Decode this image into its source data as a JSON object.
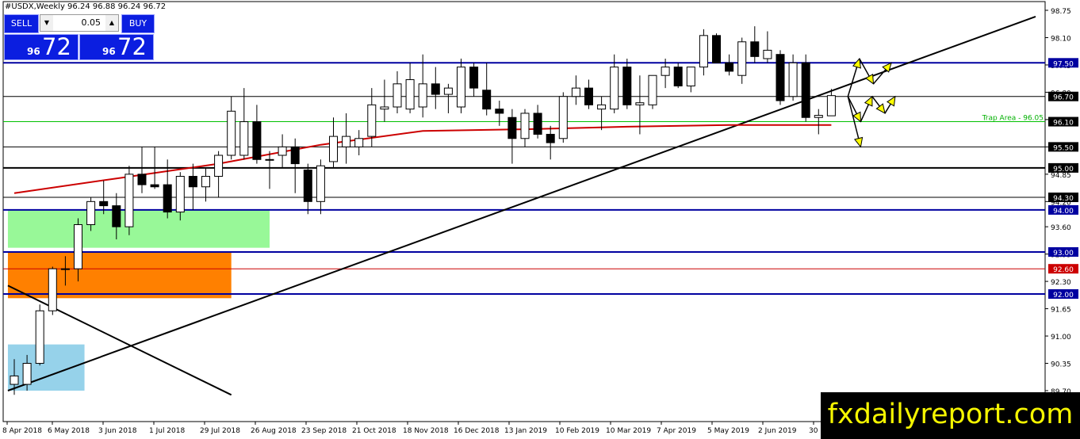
{
  "header": {
    "title": "#USDX,Weekly  96.24 96.88 96.24 96.72"
  },
  "trade_panel": {
    "sell_label": "SELL",
    "buy_label": "BUY",
    "lot": "0.05",
    "sell_small": "96",
    "sell_big": "72",
    "buy_small": "96",
    "buy_big": "72",
    "colors": {
      "button": "#0b1ee0"
    }
  },
  "brand": "fxdailyreport.com",
  "chart_data": {
    "type": "candlestick",
    "symbol": "#USDX",
    "timeframe": "Weekly",
    "ylim": [
      89.7,
      98.75
    ],
    "grid": false,
    "colors": {
      "up": "#ffffff",
      "down": "#000000",
      "ma": "#cc0000",
      "level_blue": "#0000a0",
      "zone_green": "#98f898",
      "zone_orange": "#ff8000",
      "zone_blue": "#96d2ea"
    },
    "y_ticks": [
      "98.75",
      "98.10",
      "97.45",
      "96.80",
      "96.15",
      "95.50",
      "94.85",
      "94.20",
      "93.60",
      "92.95",
      "92.30",
      "91.65",
      "91.00",
      "90.35",
      "89.70"
    ],
    "x_labels": [
      "8 Apr 2018",
      "6 May 2018",
      "3 Jun 2018",
      "1 Jul 2018",
      "29 Jul 2018",
      "26 Aug 2018",
      "23 Sep 2018",
      "21 Oct 2018",
      "18 Nov 2018",
      "16 Dec 2018",
      "13 Jan 2019",
      "10 Feb 2019",
      "10 Mar 2019",
      "7 Apr 2019",
      "5 May 2019",
      "2 Jun 2019",
      "30"
    ],
    "candles": [
      {
        "o": 89.85,
        "h": 90.45,
        "l": 89.6,
        "c": 90.05
      },
      {
        "o": 89.85,
        "h": 90.55,
        "l": 89.7,
        "c": 90.35
      },
      {
        "o": 90.35,
        "h": 91.75,
        "l": 90.3,
        "c": 91.6
      },
      {
        "o": 91.6,
        "h": 92.65,
        "l": 91.5,
        "c": 92.6
      },
      {
        "o": 92.6,
        "h": 92.9,
        "l": 92.2,
        "c": 92.6
      },
      {
        "o": 92.6,
        "h": 93.8,
        "l": 92.3,
        "c": 93.65
      },
      {
        "o": 93.65,
        "h": 94.3,
        "l": 93.5,
        "c": 94.2
      },
      {
        "o": 94.2,
        "h": 94.7,
        "l": 93.9,
        "c": 94.1
      },
      {
        "o": 94.1,
        "h": 94.4,
        "l": 93.3,
        "c": 93.6
      },
      {
        "o": 93.6,
        "h": 95.05,
        "l": 93.4,
        "c": 94.85
      },
      {
        "o": 94.85,
        "h": 95.5,
        "l": 94.4,
        "c": 94.6
      },
      {
        "o": 94.6,
        "h": 95.5,
        "l": 94.5,
        "c": 94.55
      },
      {
        "o": 94.6,
        "h": 95.2,
        "l": 93.8,
        "c": 93.95
      },
      {
        "o": 93.95,
        "h": 94.9,
        "l": 93.75,
        "c": 94.8
      },
      {
        "o": 94.8,
        "h": 95.1,
        "l": 94.0,
        "c": 94.55
      },
      {
        "o": 94.55,
        "h": 95.0,
        "l": 94.2,
        "c": 94.8
      },
      {
        "o": 94.8,
        "h": 95.4,
        "l": 94.3,
        "c": 95.3
      },
      {
        "o": 95.3,
        "h": 96.7,
        "l": 95.2,
        "c": 96.35
      },
      {
        "o": 95.3,
        "h": 96.9,
        "l": 95.2,
        "c": 96.1
      },
      {
        "o": 96.1,
        "h": 96.5,
        "l": 95.1,
        "c": 95.2
      },
      {
        "o": 95.2,
        "h": 95.4,
        "l": 94.5,
        "c": 95.2
      },
      {
        "o": 95.3,
        "h": 95.8,
        "l": 95.0,
        "c": 95.5
      },
      {
        "o": 95.5,
        "h": 95.7,
        "l": 94.4,
        "c": 95.1
      },
      {
        "o": 94.95,
        "h": 95.1,
        "l": 93.9,
        "c": 94.2
      },
      {
        "o": 94.2,
        "h": 95.2,
        "l": 93.9,
        "c": 95.05
      },
      {
        "o": 95.15,
        "h": 96.2,
        "l": 95.0,
        "c": 95.75
      },
      {
        "o": 95.5,
        "h": 96.3,
        "l": 95.1,
        "c": 95.75
      },
      {
        "o": 95.5,
        "h": 95.9,
        "l": 95.3,
        "c": 95.7
      },
      {
        "o": 95.75,
        "h": 96.9,
        "l": 95.5,
        "c": 96.5
      },
      {
        "o": 96.4,
        "h": 97.1,
        "l": 96.1,
        "c": 96.45
      },
      {
        "o": 96.45,
        "h": 97.3,
        "l": 96.3,
        "c": 97.0
      },
      {
        "o": 96.4,
        "h": 97.5,
        "l": 96.3,
        "c": 97.1
      },
      {
        "o": 96.45,
        "h": 97.7,
        "l": 96.2,
        "c": 97.0
      },
      {
        "o": 97.0,
        "h": 97.4,
        "l": 96.4,
        "c": 96.75
      },
      {
        "o": 96.75,
        "h": 97.0,
        "l": 96.3,
        "c": 96.9
      },
      {
        "o": 96.45,
        "h": 97.6,
        "l": 96.3,
        "c": 97.4
      },
      {
        "o": 97.4,
        "h": 97.5,
        "l": 96.7,
        "c": 96.9
      },
      {
        "o": 96.85,
        "h": 97.5,
        "l": 96.25,
        "c": 96.4
      },
      {
        "o": 96.4,
        "h": 96.6,
        "l": 96.0,
        "c": 96.3
      },
      {
        "o": 96.2,
        "h": 96.4,
        "l": 95.1,
        "c": 95.7
      },
      {
        "o": 95.7,
        "h": 96.4,
        "l": 95.5,
        "c": 96.3
      },
      {
        "o": 96.3,
        "h": 96.5,
        "l": 95.7,
        "c": 95.8
      },
      {
        "o": 95.8,
        "h": 96.0,
        "l": 95.2,
        "c": 95.6
      },
      {
        "o": 95.7,
        "h": 96.8,
        "l": 95.6,
        "c": 96.7
      },
      {
        "o": 96.7,
        "h": 97.2,
        "l": 96.5,
        "c": 96.9
      },
      {
        "o": 96.9,
        "h": 97.1,
        "l": 96.4,
        "c": 96.5
      },
      {
        "o": 96.4,
        "h": 96.7,
        "l": 95.9,
        "c": 96.5
      },
      {
        "o": 96.4,
        "h": 97.7,
        "l": 96.3,
        "c": 97.4
      },
      {
        "o": 97.4,
        "h": 97.6,
        "l": 96.4,
        "c": 96.5
      },
      {
        "o": 96.5,
        "h": 97.2,
        "l": 95.8,
        "c": 96.55
      },
      {
        "o": 96.5,
        "h": 97.2,
        "l": 96.4,
        "c": 97.2
      },
      {
        "o": 97.2,
        "h": 97.6,
        "l": 96.9,
        "c": 97.4
      },
      {
        "o": 97.4,
        "h": 97.5,
        "l": 96.9,
        "c": 96.95
      },
      {
        "o": 96.95,
        "h": 97.4,
        "l": 96.8,
        "c": 97.4
      },
      {
        "o": 97.4,
        "h": 98.3,
        "l": 97.2,
        "c": 98.15
      },
      {
        "o": 98.15,
        "h": 98.2,
        "l": 97.5,
        "c": 97.5
      },
      {
        "o": 97.5,
        "h": 97.7,
        "l": 97.2,
        "c": 97.3
      },
      {
        "o": 97.2,
        "h": 98.1,
        "l": 97.0,
        "c": 98.0
      },
      {
        "o": 98.0,
        "h": 98.37,
        "l": 97.5,
        "c": 97.65
      },
      {
        "o": 97.6,
        "h": 98.25,
        "l": 97.5,
        "c": 97.8
      },
      {
        "o": 97.7,
        "h": 97.8,
        "l": 96.5,
        "c": 96.6
      },
      {
        "o": 96.7,
        "h": 97.7,
        "l": 96.6,
        "c": 97.5
      },
      {
        "o": 97.5,
        "h": 97.7,
        "l": 96.1,
        "c": 96.2
      },
      {
        "o": 96.2,
        "h": 96.4,
        "l": 95.8,
        "c": 96.25
      },
      {
        "o": 96.24,
        "h": 96.88,
        "l": 96.24,
        "c": 96.72
      }
    ],
    "ma": [
      {
        "i": 0,
        "y": 94.4
      },
      {
        "i": 8,
        "y": 94.75
      },
      {
        "i": 16,
        "y": 95.1
      },
      {
        "i": 24,
        "y": 95.55
      },
      {
        "i": 32,
        "y": 95.88
      },
      {
        "i": 40,
        "y": 95.92
      },
      {
        "i": 48,
        "y": 95.98
      },
      {
        "i": 56,
        "y": 96.02
      },
      {
        "i": 64,
        "y": 96.02
      }
    ],
    "h_lines": [
      {
        "price": 97.5,
        "label": "97.50",
        "color": "#0000a0",
        "bold": true
      },
      {
        "price": 96.7,
        "label": "96.70",
        "color": "#000000",
        "bold": false
      },
      {
        "price": 96.1,
        "label": "96.10",
        "color": "#00c000",
        "bold": false
      },
      {
        "price": 95.5,
        "label": "95.50",
        "color": "#000000",
        "bold": false
      },
      {
        "price": 95.0,
        "label": "95.00",
        "color": "#000000",
        "bold": true
      },
      {
        "price": 94.3,
        "label": "94.30",
        "color": "#000000",
        "bold": false
      },
      {
        "price": 94.0,
        "label": "94.00",
        "color": "#0000a0",
        "bold": true
      },
      {
        "price": 93.0,
        "label": "93.00",
        "color": "#0000a0",
        "bold": true
      },
      {
        "price": 92.6,
        "label": "92.60",
        "color": "#cc0000",
        "bold": false
      },
      {
        "price": 92.0,
        "label": "92.00",
        "color": "#0000a0",
        "bold": true
      }
    ],
    "zones": [
      {
        "name": "green",
        "i0": -0.5,
        "i1": 20.0,
        "p_top": 94.0,
        "p_bot": 93.1,
        "color": "#98f898"
      },
      {
        "name": "orange",
        "i0": -0.5,
        "i1": 17.0,
        "p_top": 93.0,
        "p_bot": 91.9,
        "color": "#ff8000"
      },
      {
        "name": "blue",
        "i0": -0.5,
        "i1": 5.5,
        "p_top": 90.8,
        "p_bot": 89.7,
        "color": "#96d2ea"
      }
    ],
    "annotation": "Trap Area - 96.05",
    "trend_lines": [
      {
        "i0": -0.5,
        "p0": 89.7,
        "i1": 80.0,
        "p1": 98.6
      },
      {
        "i0": -0.5,
        "p0": 92.2,
        "i1": 17.0,
        "p1": 89.6
      }
    ],
    "scenario_arrows": [
      {
        "i0": 65.3,
        "p0": 96.7,
        "i1": 66.2,
        "p1": 97.6
      },
      {
        "i0": 66.2,
        "p0": 97.6,
        "i1": 67.3,
        "p1": 97.0
      },
      {
        "i0": 67.3,
        "p0": 97.0,
        "i1": 68.7,
        "p1": 97.5
      },
      {
        "i0": 65.3,
        "p0": 96.7,
        "i1": 66.3,
        "p1": 96.1
      },
      {
        "i0": 66.3,
        "p0": 96.1,
        "i1": 67.2,
        "p1": 96.7
      },
      {
        "i0": 67.2,
        "p0": 96.7,
        "i1": 68.2,
        "p1": 96.3
      },
      {
        "i0": 68.2,
        "p0": 96.3,
        "i1": 69.0,
        "p1": 96.7
      },
      {
        "i0": 65.3,
        "p0": 96.7,
        "i1": 66.3,
        "p1": 95.5
      }
    ]
  }
}
